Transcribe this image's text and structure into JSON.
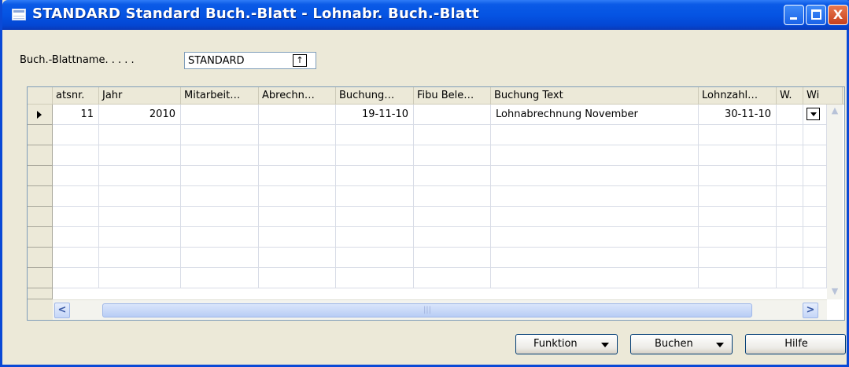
{
  "window": {
    "title": "STANDARD Standard Buch.-Blatt - Lohnabr. Buch.-Blatt",
    "minimize_icon": "minimize-icon",
    "maximize_icon": "maximize-icon",
    "close_label": "X"
  },
  "journal_name": {
    "label": "Buch.-Blattname. . . . .",
    "value": "STANDARD",
    "lookup_icon": "↑"
  },
  "table": {
    "columns": [
      "atsnr.",
      "Jahr",
      "Mitarbeit…",
      "Abrechn…",
      "Buchung…",
      "Fibu Bele…",
      "Buchung Text",
      "Lohnzahl…",
      "W.",
      "Wi"
    ],
    "rows": [
      {
        "atsnr": "11",
        "jahr": "2010",
        "mitarbeiter": "",
        "abrechnung": "",
        "buchungsdatum": "19-11-10",
        "fibu_beleg": "",
        "buchung_text": "Lohnabrechnung November",
        "lohnzahlung": "30-11-10",
        "w": "",
        "wi": ""
      }
    ],
    "empty_rows": 9
  },
  "buttons": {
    "funktion": "Funktion",
    "buchen": "Buchen",
    "hilfe": "Hilfe"
  },
  "colors": {
    "titlebar": "#0554e3",
    "window_bg": "#ece9d8",
    "grid_border": "#7f9db9"
  }
}
